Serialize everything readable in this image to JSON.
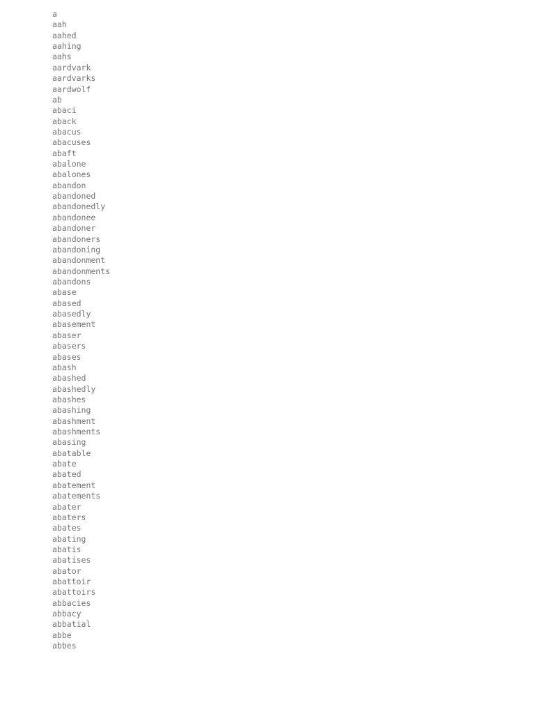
{
  "document": {
    "type": "plain-text-word-list",
    "background_color": "#ffffff",
    "text_color": "#737373",
    "entry_count": 60,
    "entries": [
      "a",
      "aah",
      "aahed",
      "aahing",
      "aahs",
      "aardvark",
      "aardvarks",
      "aardwolf",
      "ab",
      "abaci",
      "aback",
      "abacus",
      "abacuses",
      "abaft",
      "abalone",
      "abalones",
      "abandon",
      "abandoned",
      "abandonedly",
      "abandonee",
      "abandoner",
      "abandoners",
      "abandoning",
      "abandonment",
      "abandonments",
      "abandons",
      "abase",
      "abased",
      "abasedly",
      "abasement",
      "abaser",
      "abasers",
      "abases",
      "abash",
      "abashed",
      "abashedly",
      "abashes",
      "abashing",
      "abashment",
      "abashments",
      "abasing",
      "abatable",
      "abate",
      "abated",
      "abatement",
      "abatements",
      "abater",
      "abaters",
      "abates",
      "abating",
      "abatis",
      "abatises",
      "abator",
      "abattoir",
      "abattoirs",
      "abbacies",
      "abbacy",
      "abbatial",
      "abbe",
      "abbes"
    ]
  }
}
